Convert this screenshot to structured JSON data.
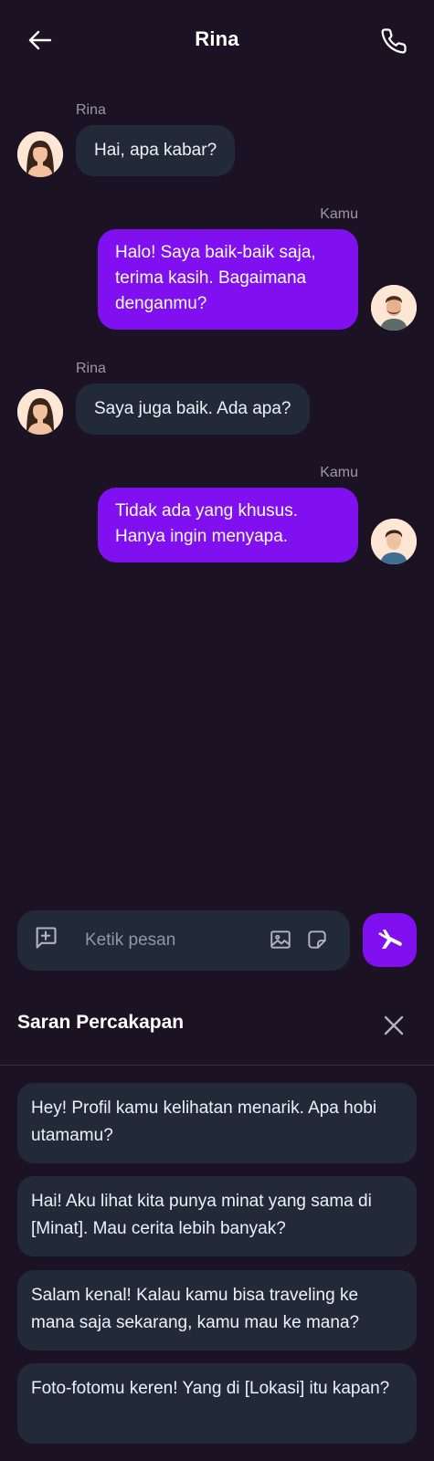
{
  "header": {
    "title": "Rina",
    "back_icon": "arrow-left-icon",
    "call_icon": "phone-icon"
  },
  "messages": [
    {
      "sender": "Rina",
      "text": "Hai, apa kabar?",
      "direction": "incoming"
    },
    {
      "sender": "Kamu",
      "text": "Halo! Saya baik-baik saja, terima kasih. Bagaimana denganmu?",
      "direction": "outgoing"
    },
    {
      "sender": "Rina",
      "text": "Saya juga baik. Ada apa?",
      "direction": "incoming"
    },
    {
      "sender": "Kamu",
      "text": "Tidak ada yang khusus. Hanya ingin menyapa.",
      "direction": "outgoing"
    }
  ],
  "composer": {
    "placeholder": "Ketik pesan",
    "value": "",
    "icons": [
      "add-comment-icon",
      "image-icon",
      "sticker-icon"
    ],
    "send_icon": "send-icon"
  },
  "suggestions": {
    "title": "Saran Percakapan",
    "close_icon": "close-icon",
    "items": [
      "Hey! Profil kamu kelihatan menarik. Apa hobi utamamu?",
      "Hai! Aku lihat kita punya minat yang sama di [Minat]. Mau cerita lebih banyak?",
      "Salam kenal! Kalau kamu bisa traveling ke mana saja sekarang, kamu mau ke mana?",
      "Foto-fotomu keren! Yang di [Lokasi] itu kapan?"
    ]
  },
  "colors": {
    "background": "#1b1223",
    "accent": "#8010f0",
    "bubble_incoming": "#222a3a",
    "muted_text": "#9c98a6"
  }
}
